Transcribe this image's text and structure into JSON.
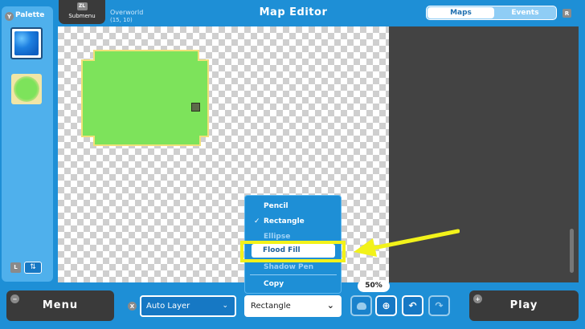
{
  "header": {
    "submenu_button": {
      "key": "ZL",
      "label": "Submenu"
    },
    "map_name": "Overworld",
    "coordinates": "(15, 10)",
    "title": "Map Editor",
    "tabs": [
      {
        "label": "Maps",
        "active": true
      },
      {
        "label": "Events",
        "active": false
      }
    ],
    "tabs_key": "R"
  },
  "palette": {
    "key": "Y",
    "title": "Palette",
    "tiles": [
      {
        "icon": "water-tile-icon",
        "selected": true
      },
      {
        "icon": "grass-tile-icon",
        "selected": false
      }
    ],
    "bottom_key": "L",
    "bottom_icon": "swap-arrows-icon"
  },
  "tool_menu": {
    "items": [
      {
        "label": "Pencil",
        "checked": false,
        "highlighted": false,
        "dimmed": false
      },
      {
        "label": "Rectangle",
        "checked": true,
        "highlighted": false,
        "dimmed": false
      },
      {
        "label": "Ellipse",
        "checked": false,
        "highlighted": false,
        "dimmed": true
      },
      {
        "label": "Flood Fill",
        "checked": false,
        "highlighted": true,
        "dimmed": false
      },
      {
        "label": "Shadow Pen",
        "checked": false,
        "highlighted": false,
        "dimmed": true
      },
      {
        "label": "Copy",
        "checked": false,
        "highlighted": false,
        "dimmed": false
      }
    ]
  },
  "bottom_bar": {
    "menu_button": {
      "key": "−",
      "label": "Menu"
    },
    "layer_key": "X",
    "layer_select": "Auto Layer",
    "tool_select": "Rectangle",
    "zoom": "50%",
    "play_button": {
      "key": "+",
      "label": "Play"
    }
  },
  "colors": {
    "background": "#1e8fd6",
    "panel": "#4fb0ec",
    "grass": "#7de35b",
    "highlight": "#f2f21a",
    "dark_button": "#3a3a3a"
  }
}
